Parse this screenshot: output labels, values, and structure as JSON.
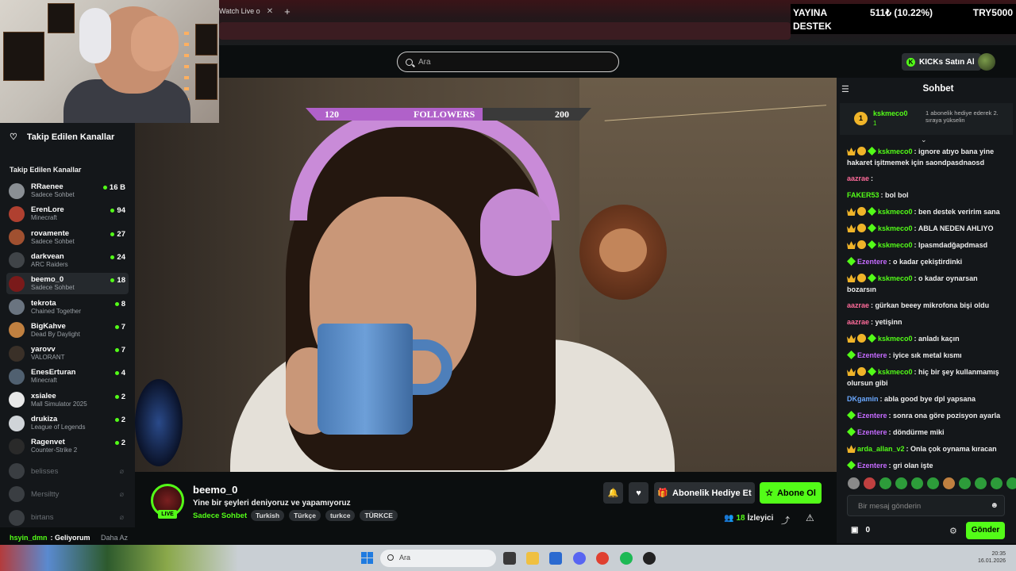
{
  "browser": {
    "tab_title": "Watch Live o",
    "tab_close": "✕",
    "new_tab": "+"
  },
  "stats_overlay": {
    "line1": "YAYINA",
    "line2": "DESTEK",
    "amount": "511₺ (10.22%)",
    "target": "TRY5000"
  },
  "header": {
    "search_placeholder": "Ara",
    "kicks_button": "KICKs Satın Al"
  },
  "sidebar": {
    "title": "Takip Edilen Kanallar",
    "section_label": "Takip Edilen Kanallar",
    "channels": [
      {
        "name": "RRaenee",
        "category": "Sadece Sohbet",
        "viewers": "16 B",
        "color": "#8a8f94"
      },
      {
        "name": "ErenLore",
        "category": "Minecraft",
        "viewers": "94",
        "color": "#b04030"
      },
      {
        "name": "rovamente",
        "category": "Sadece Sohbet",
        "viewers": "27",
        "color": "#a05030"
      },
      {
        "name": "darkvean",
        "category": "ARC Raiders",
        "viewers": "24",
        "color": "#404448"
      },
      {
        "name": "beemo_0",
        "category": "Sadece Sohbet",
        "viewers": "18",
        "color": "#7a1a1a"
      },
      {
        "name": "tekrota",
        "category": "Chained Together",
        "viewers": "8",
        "color": "#6a7480"
      },
      {
        "name": "BigKahve",
        "category": "Dead By Daylight",
        "viewers": "7",
        "color": "#c08040"
      },
      {
        "name": "yarovv",
        "category": "VALORANT",
        "viewers": "7",
        "color": "#3a3028"
      },
      {
        "name": "EnesErturan",
        "category": "Minecraft",
        "viewers": "4",
        "color": "#506070"
      },
      {
        "name": "xsialee",
        "category": "Mall Simulator 2025",
        "viewers": "2",
        "color": "#e8e8e8"
      },
      {
        "name": "drukiza",
        "category": "League of Legends",
        "viewers": "2",
        "color": "#d0d4d8"
      },
      {
        "name": "Ragenvet",
        "category": "Counter-Strike 2",
        "viewers": "2",
        "color": "#2a2a2a"
      }
    ],
    "offline": [
      "belisses",
      "Mersiltty",
      "birtans"
    ],
    "show_less": "Daha Az"
  },
  "ticker": {
    "user": "hsyin_dmn",
    "text": ": Geliyorum"
  },
  "follower_goal": {
    "current": "120",
    "label": "FOLLOWERS",
    "target": "200",
    "progress": 0.6
  },
  "stream": {
    "live_badge": "LIVE",
    "channel": "beemo_0",
    "title": "Yine bir şeyleri deniyoruz ve yapamıyoruz",
    "category": "Sadece Sohbet",
    "tags": [
      "Turkish",
      "Türkçe",
      "turkce",
      "TÜRKCE"
    ],
    "gift_button": "Abonelik Hediye Et",
    "subscribe_button": "Abone Ol",
    "viewers_count": "18",
    "viewers_label": "İzleyici"
  },
  "chat": {
    "title": "Sohbet",
    "pinned": {
      "rank": "1",
      "user": "kskmeco0",
      "count": "1",
      "text": "1 abonelik hediye ederek 2. sıraya yükselin"
    },
    "messages": [
      {
        "user": "kskmeco0",
        "color": "#53fc18",
        "badges": [
          "crown",
          "sub",
          "gem"
        ],
        "text": " ignore atıyo bana yine hakaret işitmemek için saondpasdnaosd"
      },
      {
        "user": "aazrae",
        "color": "#ff6b9a",
        "badges": [],
        "text": " "
      },
      {
        "user": "FAKER53",
        "color": "#53fc18",
        "badges": [],
        "text": " bol bol"
      },
      {
        "user": "kskmeco0",
        "color": "#53fc18",
        "badges": [
          "crown",
          "sub",
          "gem"
        ],
        "text": " ben destek veririm sana"
      },
      {
        "user": "kskmeco0",
        "color": "#53fc18",
        "badges": [
          "crown",
          "sub",
          "gem"
        ],
        "text": " ABLA NEDEN AHLIYO"
      },
      {
        "user": "kskmeco0",
        "color": "#53fc18",
        "badges": [
          "crown",
          "sub",
          "gem"
        ],
        "text": " lpasmdadğapdmasd"
      },
      {
        "user": "Ezentere",
        "color": "#c56bff",
        "badges": [
          "gem"
        ],
        "text": " o kadar çekiştirdinki"
      },
      {
        "user": "kskmeco0",
        "color": "#53fc18",
        "badges": [
          "crown",
          "sub",
          "gem"
        ],
        "text": " o kadar oynarsan bozarsın"
      },
      {
        "user": "aazrae",
        "color": "#ff6b9a",
        "badges": [],
        "text": " gürkan beeey mikrofona bişi oldu"
      },
      {
        "user": "aazrae",
        "color": "#ff6b9a",
        "badges": [],
        "text": " yetişinn"
      },
      {
        "user": "kskmeco0",
        "color": "#53fc18",
        "badges": [
          "crown",
          "sub",
          "gem"
        ],
        "text": " anladı kaçın"
      },
      {
        "user": "Ezentere",
        "color": "#c56bff",
        "badges": [
          "gem"
        ],
        "text": " iyice sık metal kısmı"
      },
      {
        "user": "kskmeco0",
        "color": "#53fc18",
        "badges": [
          "crown",
          "sub",
          "gem"
        ],
        "text": " hiç bir şey kullanmamış olursun gibi"
      },
      {
        "user": "DKgamin",
        "color": "#6aa8ff",
        "badges": [],
        "text": " abla good bye dpl yapsana"
      },
      {
        "user": "Ezentere",
        "color": "#c56bff",
        "badges": [
          "gem"
        ],
        "text": " sonra ona göre pozisyon ayarla"
      },
      {
        "user": "Ezentere",
        "color": "#c56bff",
        "badges": [
          "gem"
        ],
        "text": " döndürme miki"
      },
      {
        "user": "arda_allan_v2",
        "color": "#53fc18",
        "badges": [
          "crown"
        ],
        "text": " Onla çok oynama kıracan"
      },
      {
        "user": "Ezentere",
        "color": "#c56bff",
        "badges": [
          "gem"
        ],
        "text": " gri olan işte"
      }
    ],
    "input_placeholder": "Bir mesaj gönderin",
    "kicks_count": "0",
    "send_button": "Gönder"
  },
  "taskbar": {
    "search_placeholder": "Ara",
    "time": "20:35",
    "date": "16.01.2026"
  }
}
